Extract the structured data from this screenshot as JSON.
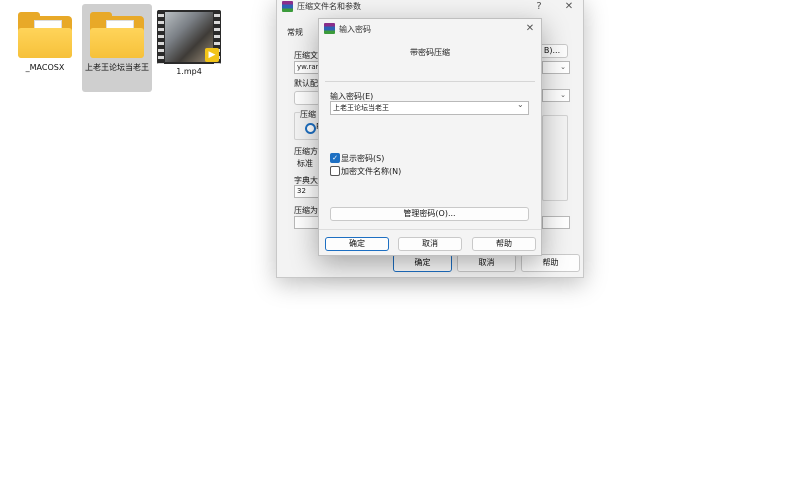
{
  "desktop": {
    "items": [
      {
        "label": "_MACOSX",
        "type": "folder"
      },
      {
        "label": "上老王论坛当老王",
        "type": "folder"
      },
      {
        "label": "1.mp4",
        "type": "video"
      }
    ]
  },
  "main_window": {
    "title": "压缩文件名和参数",
    "help_glyph": "?",
    "close_glyph": "✕",
    "tab_general": "常规",
    "label_archive_name": "压缩文",
    "archive_name_value": "yw.rar",
    "browse_suffix": "B)...",
    "label_default_profile": "默认配",
    "label_compress_format": "压缩",
    "radio_partial": "R",
    "label_method": "压缩方",
    "method_value": "标准",
    "label_dict": "字典大",
    "dict_value": "32",
    "label_split": "压缩为",
    "ok_label": "确定",
    "cancel_label": "取消",
    "help_label": "帮助"
  },
  "password_dialog": {
    "title": "输入密码",
    "close_glyph": "✕",
    "heading": "带密码压缩",
    "label_enter_password": "输入密码(E)",
    "password_value": "上老王论坛当老王",
    "dropdown_glyph": "⌄",
    "show_password_label": "显示密码(S)",
    "show_password_checked": true,
    "encrypt_names_label": "加密文件名称(N)",
    "encrypt_names_checked": false,
    "check_glyph": "✓",
    "manage_passwords_label": "管理密码(O)...",
    "ok_label": "确定",
    "cancel_label": "取消",
    "help_label": "帮助"
  }
}
